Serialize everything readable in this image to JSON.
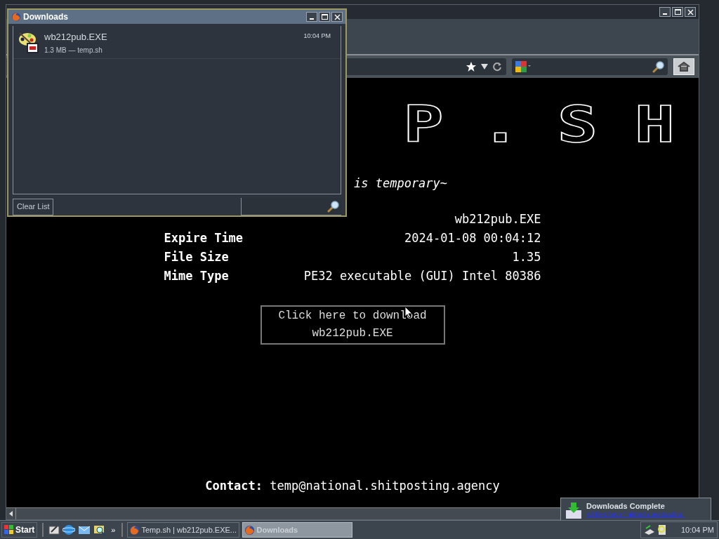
{
  "browser": {
    "page": {
      "logo": "P.SH",
      "tagline": "is temporary~",
      "rows": [
        {
          "value": "wb212pub.EXE"
        },
        {
          "label": "Expire Time",
          "value": "2024-01-08 00:04:12"
        },
        {
          "label": "File Size",
          "value": "1.35"
        },
        {
          "label": "Mime Type",
          "value": "PE32 executable (GUI) Intel 80386"
        }
      ],
      "download_button": [
        "Click here to download",
        "wb212pub.EXE"
      ],
      "contact": "**Contact:** temp@national.shitposting.agency"
    }
  },
  "downloads_window": {
    "title": "Downloads",
    "items": [
      {
        "name": "wb212pub.EXE",
        "details": "1.3 MB — temp.sh",
        "time": "10:04 PM"
      }
    ],
    "clear_button": "Clear List"
  },
  "notification": {
    "title": "Downloads Complete",
    "message": "All files have finished downloading."
  },
  "taskbar": {
    "start": "Start",
    "overflow": "»",
    "tasks": [
      {
        "label": "Temp.sh | wb212pub.EXE...",
        "selected": false
      },
      {
        "label": "Downloads",
        "selected": true
      }
    ],
    "clock": "10:04 PM"
  }
}
